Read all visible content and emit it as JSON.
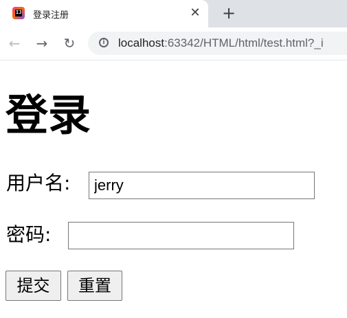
{
  "browser": {
    "tab": {
      "favicon_glyph": "IJ",
      "title": "登录注册",
      "close_symbol": "✕"
    },
    "new_tab_symbol": "+",
    "nav": {
      "back_symbol": "←",
      "forward_symbol": "→",
      "reload_symbol": "↻"
    },
    "address": {
      "info_symbol": "i",
      "host": "localhost",
      "rest": ":63342/HTML/html/test.html?_i"
    }
  },
  "page": {
    "heading": "登录",
    "form": {
      "username_label": "用户名:",
      "username_value": "jerry",
      "password_label": "密码:",
      "password_value": "",
      "submit_label": "提交",
      "reset_label": "重置"
    }
  }
}
